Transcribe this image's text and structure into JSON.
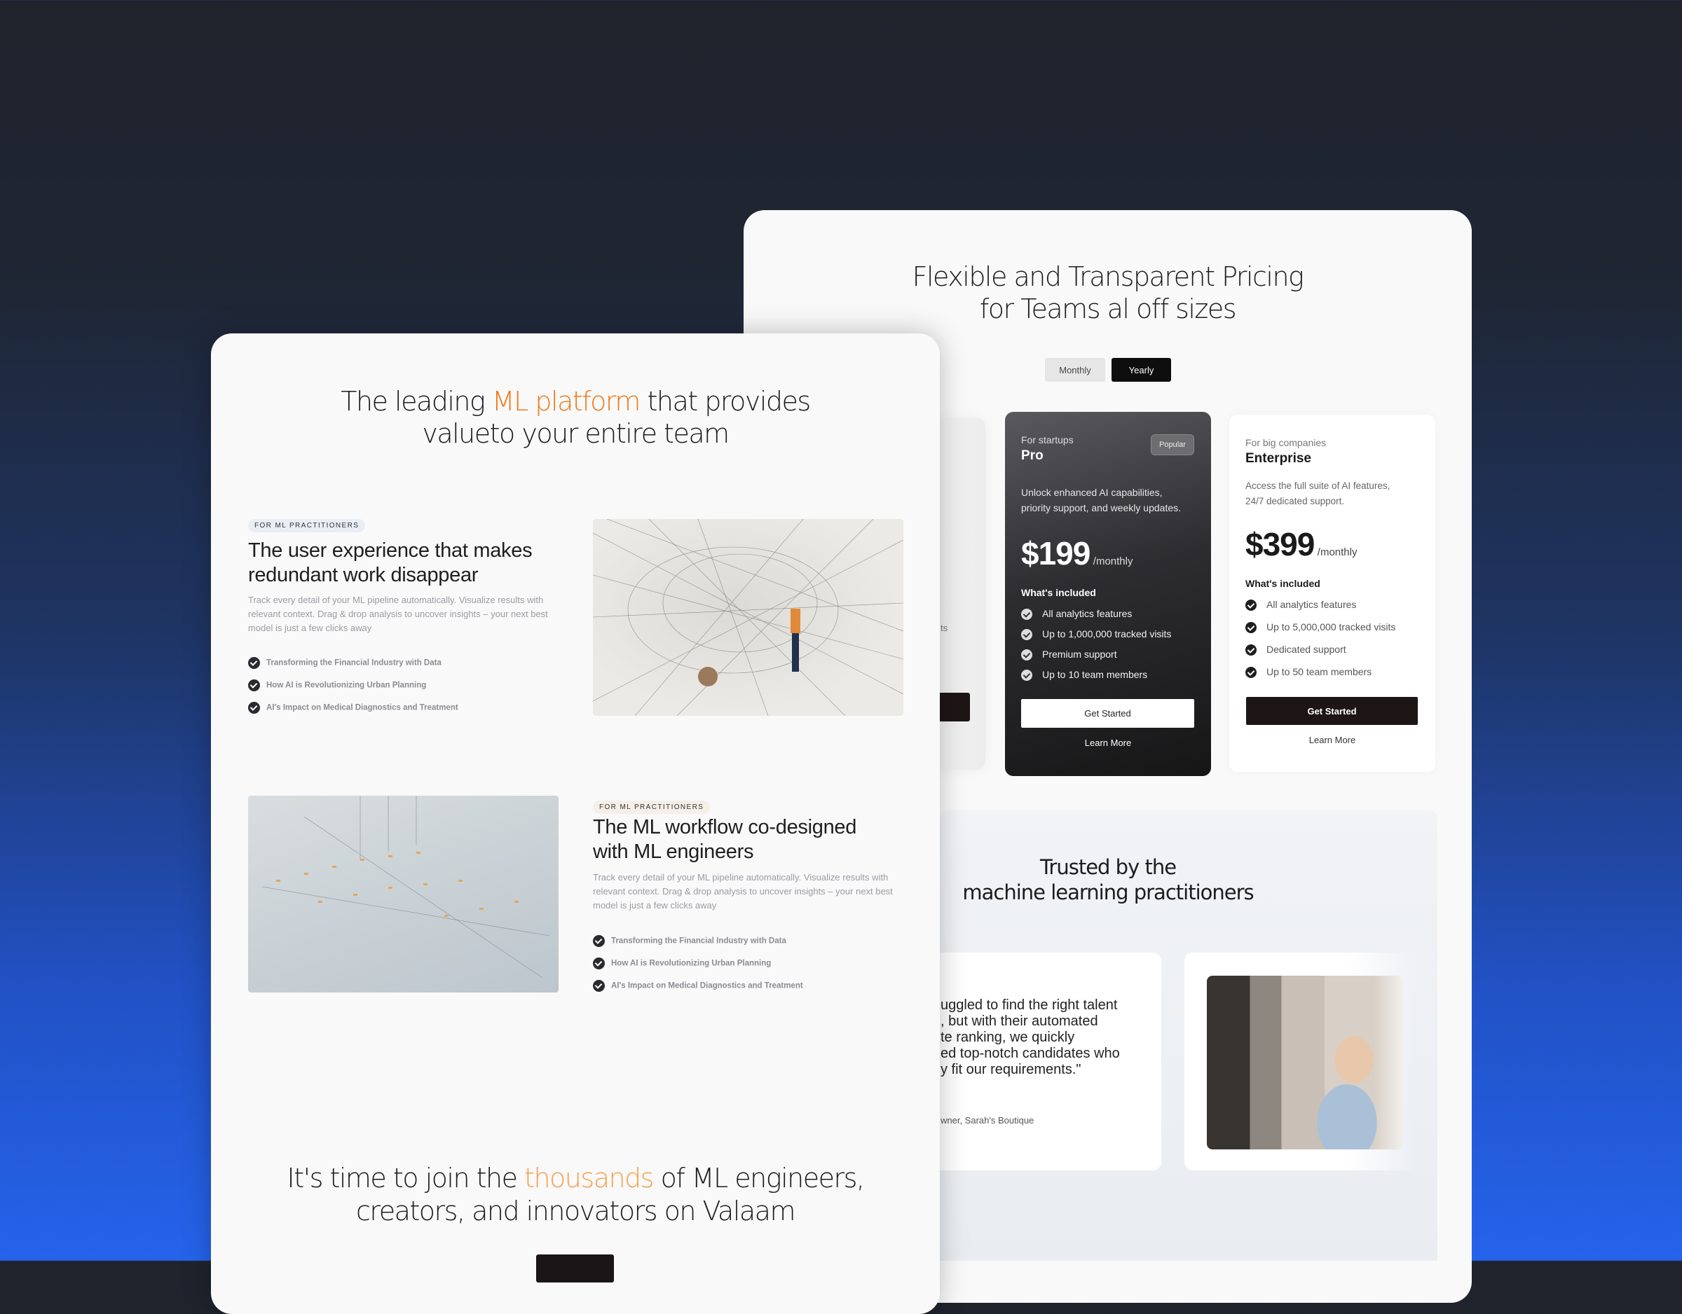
{
  "pricing": {
    "title_line1": "Flexible and Transparent Pricing",
    "title_line2": "for Teams al off sizes",
    "toggle": {
      "monthly": "Monthly",
      "yearly": "Yearly",
      "selected": "Yearly"
    },
    "partial_plan": {
      "feature_fragment": "ts"
    },
    "plans": [
      {
        "audience": "For startups",
        "name": "Pro",
        "badge": "Popular",
        "description_line1": "Unlock enhanced AI capabilities,",
        "description_line2": "priority support, and weekly updates.",
        "price": "$199",
        "period": "/monthly",
        "included_label": "What's included",
        "features": [
          "All analytics features",
          "Up to 1,000,000 tracked visits",
          "Premium support",
          "Up to 10 team members"
        ],
        "cta": "Get Started",
        "secondary": "Learn More"
      },
      {
        "audience": "For big companies",
        "name": "Enterprise",
        "description_line1": "Access the full suite of AI features,",
        "description_line2": "24/7 dedicated support.",
        "price": "$399",
        "period": "/monthly",
        "included_label": "What's included",
        "features": [
          "All analytics features",
          "Up to 5,000,000 tracked visits",
          "Dedicated support",
          "Up to 50 team members"
        ],
        "cta": "Get Started",
        "secondary": "Learn More"
      }
    ]
  },
  "trusted": {
    "title_line1": "Trusted by the",
    "title_line2": "machine learning practitioners",
    "quote_lines": [
      "uggled to find the right talent",
      ", but with their automated",
      "te ranking, we quickly",
      "ed top-notch candidates who",
      "y fit our requirements.\""
    ],
    "author": "wner, Sarah's Boutique"
  },
  "hero": {
    "before": "The leading ",
    "highlight": "ML platform",
    "after": " that provides",
    "line2": "valueto your entire team",
    "accent": "#f07a1a"
  },
  "features": [
    {
      "badge": "FOR ML PRACTITIONERS",
      "heading_line1": "The user experience that makes",
      "heading_line2": "redundant work disappear",
      "description": "Track every detail of your ML pipeline automatically. Visualize results with relevant context. Drag & drop analysis to uncover insights – your next best model is just a few clicks away",
      "checklist": [
        "Transforming the Financial Industry with Data",
        "How AI is Revolutionizing Urban Planning",
        "AI's Impact on Medical Diagnostics and Treatment"
      ]
    },
    {
      "badge": "FOR ML PRACTITIONERS",
      "heading_line1": "The ML workflow co-designed",
      "heading_line2": "with ML engineers",
      "description": "Track every detail of your ML pipeline automatically. Visualize results with relevant context. Drag & drop analysis to uncover insights – your next best model is just a few clicks away",
      "checklist": [
        "Transforming the Financial Industry with Data",
        "How AI is Revolutionizing Urban Planning",
        "AI's Impact on Medical Diagnostics and Treatment"
      ]
    }
  ],
  "cta": {
    "before": "It's time to join the ",
    "highlight": "thousands",
    "after": " of ML engineers,",
    "line2": "creators, and innovators on Valaam",
    "accent": "#f5a04a"
  }
}
